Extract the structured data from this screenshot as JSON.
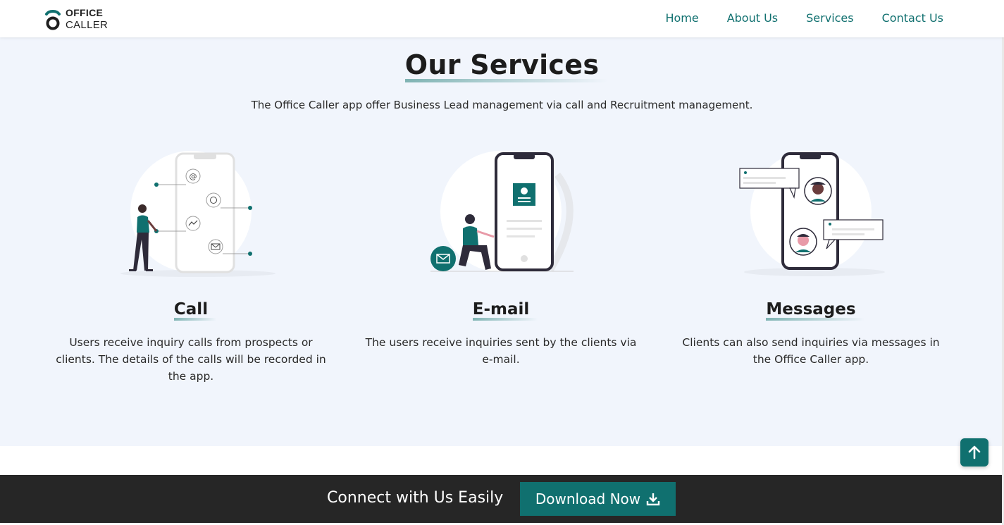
{
  "brand": {
    "line1": "OFFICE",
    "line2": "CALLER",
    "accent": "#10706f"
  },
  "nav": {
    "items": [
      "Home",
      "About Us",
      "Services",
      "Contact Us"
    ]
  },
  "services": {
    "title": "Our Services",
    "subtitle": "The Office Caller app offer Business Lead management via call and Recruitment management.",
    "cards": [
      {
        "title": "Call",
        "text": "Users receive inquiry calls from prospects or clients. The details of the calls will be recorded in the app.",
        "icon": "phone-contacts-illustration"
      },
      {
        "title": "E-mail",
        "text": "The users receive inquiries sent by the clients via e-mail.",
        "icon": "email-phone-illustration"
      },
      {
        "title": "Messages",
        "text": "Clients can also send inquiries via messages in the Office Caller app.",
        "icon": "chat-phone-illustration"
      }
    ]
  },
  "cta": {
    "text": "Connect with Us Easily",
    "button": "Download Now",
    "button_icon": "download-icon"
  },
  "back_to_top": {
    "icon": "arrow-up-icon"
  }
}
